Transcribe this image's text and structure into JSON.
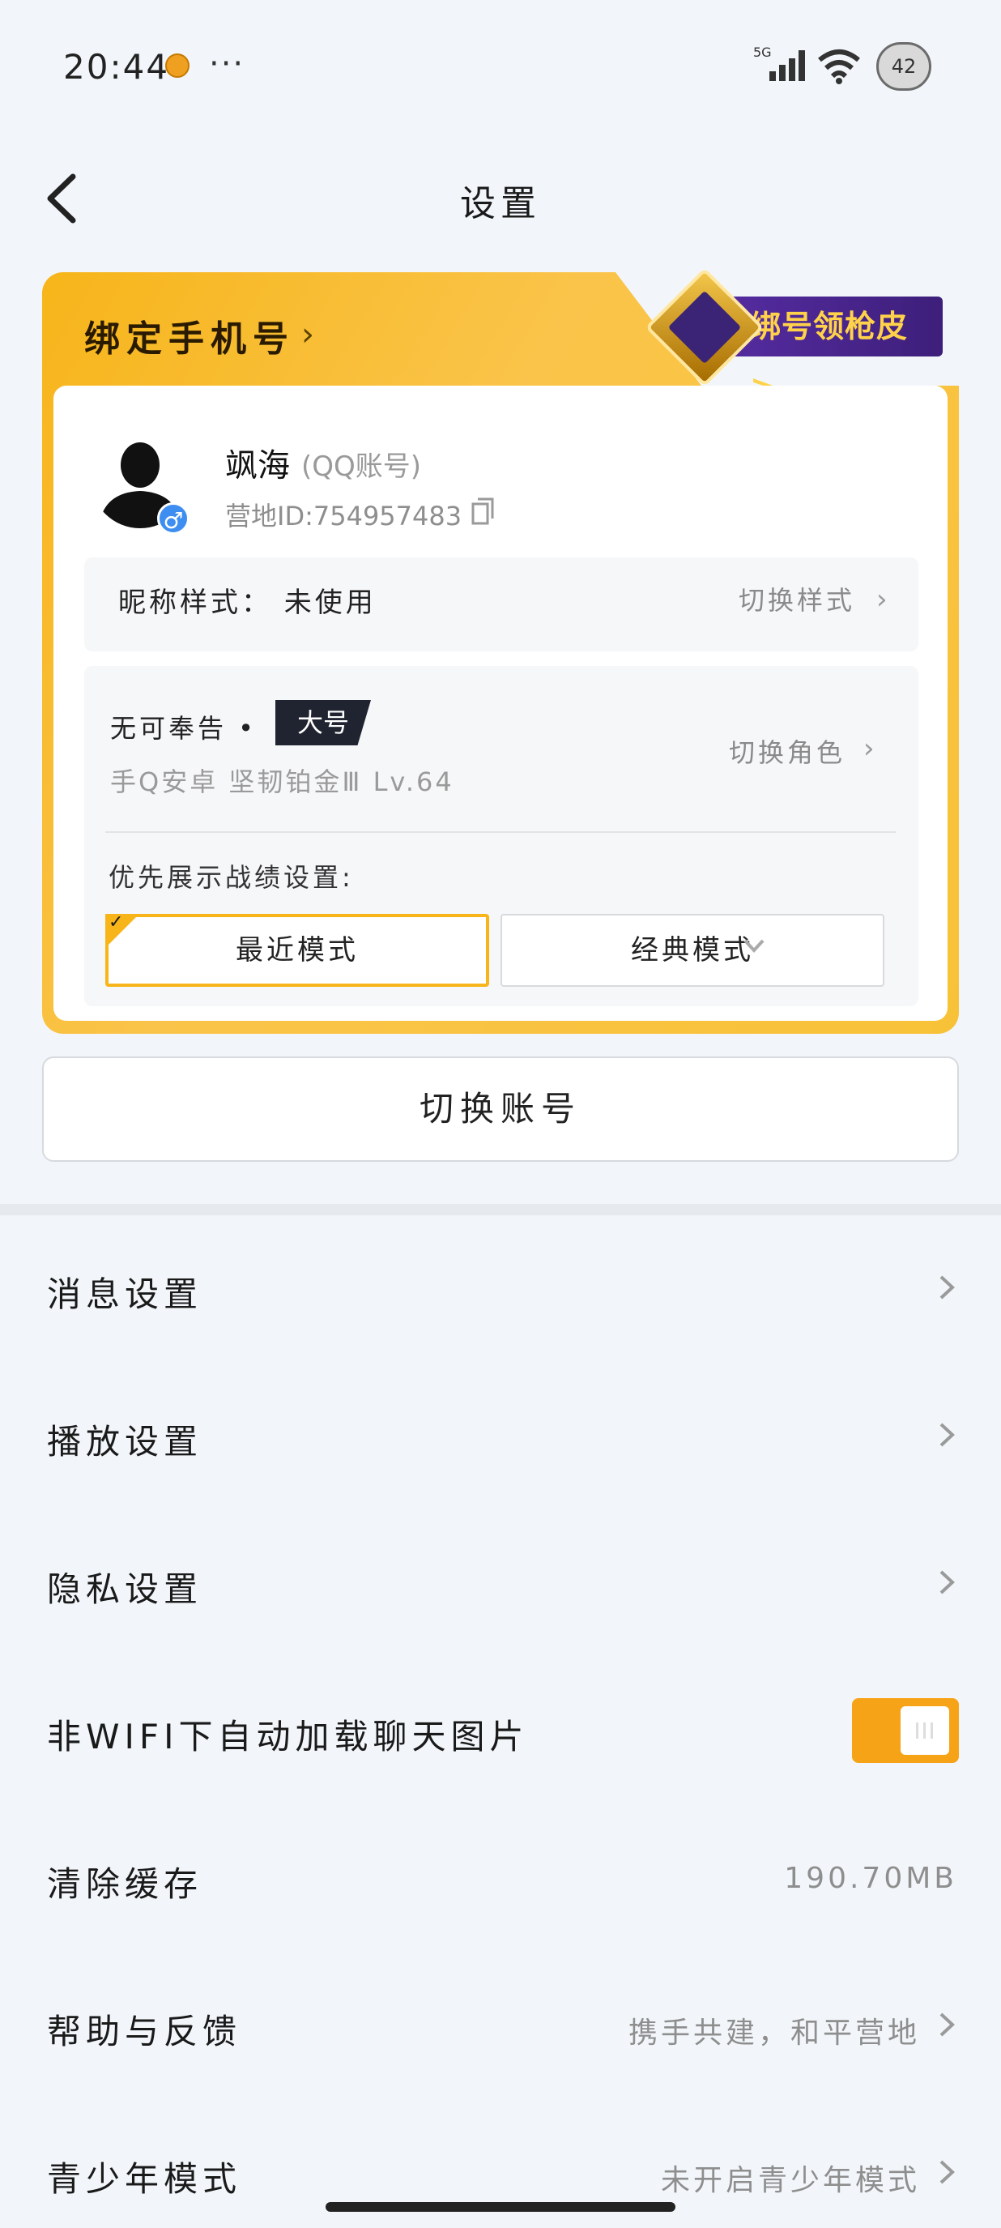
{
  "status_bar": {
    "time": "20:44",
    "more": "···",
    "network": "5G",
    "avatar_text": "42"
  },
  "header": {
    "title": "设置"
  },
  "bind_card": {
    "bind_phone_label": "绑定手机号",
    "promo_text": "绑号领枪皮 >"
  },
  "profile": {
    "name": "飒海",
    "account_type": "(QQ账号)",
    "camp_id": "营地ID:754957483",
    "gender_symbol": "♂"
  },
  "nickname_style": {
    "label": "昵称样式：  未使用",
    "switch_label": "切换样式"
  },
  "role": {
    "name": "无可奉告 •",
    "tag": "大号",
    "detail": "手Q安卓  坚韧铂金Ⅲ  Lv.64",
    "switch_label": "切换角色",
    "record_setting_label": "优先展示战绩设置:",
    "modes": [
      {
        "label": "最近模式",
        "selected": true
      },
      {
        "label": "经典模式",
        "selected": false
      }
    ]
  },
  "switch_account_label": "切换账号",
  "settings": [
    {
      "label": "消息设置",
      "value": ""
    },
    {
      "label": "播放设置",
      "value": ""
    },
    {
      "label": "隐私设置",
      "value": ""
    },
    {
      "label": "非WIFI下自动加载聊天图片",
      "value": "",
      "toggle_on": true
    },
    {
      "label": "清除缓存",
      "value": "190.70MB"
    },
    {
      "label": "帮助与反馈",
      "value": "携手共建，和平营地"
    },
    {
      "label": "青少年模式",
      "value": "未开启青少年模式"
    }
  ],
  "colors": {
    "accent": "#f7b51a",
    "toggle": "#f7a318",
    "promo": "#4a2590"
  }
}
